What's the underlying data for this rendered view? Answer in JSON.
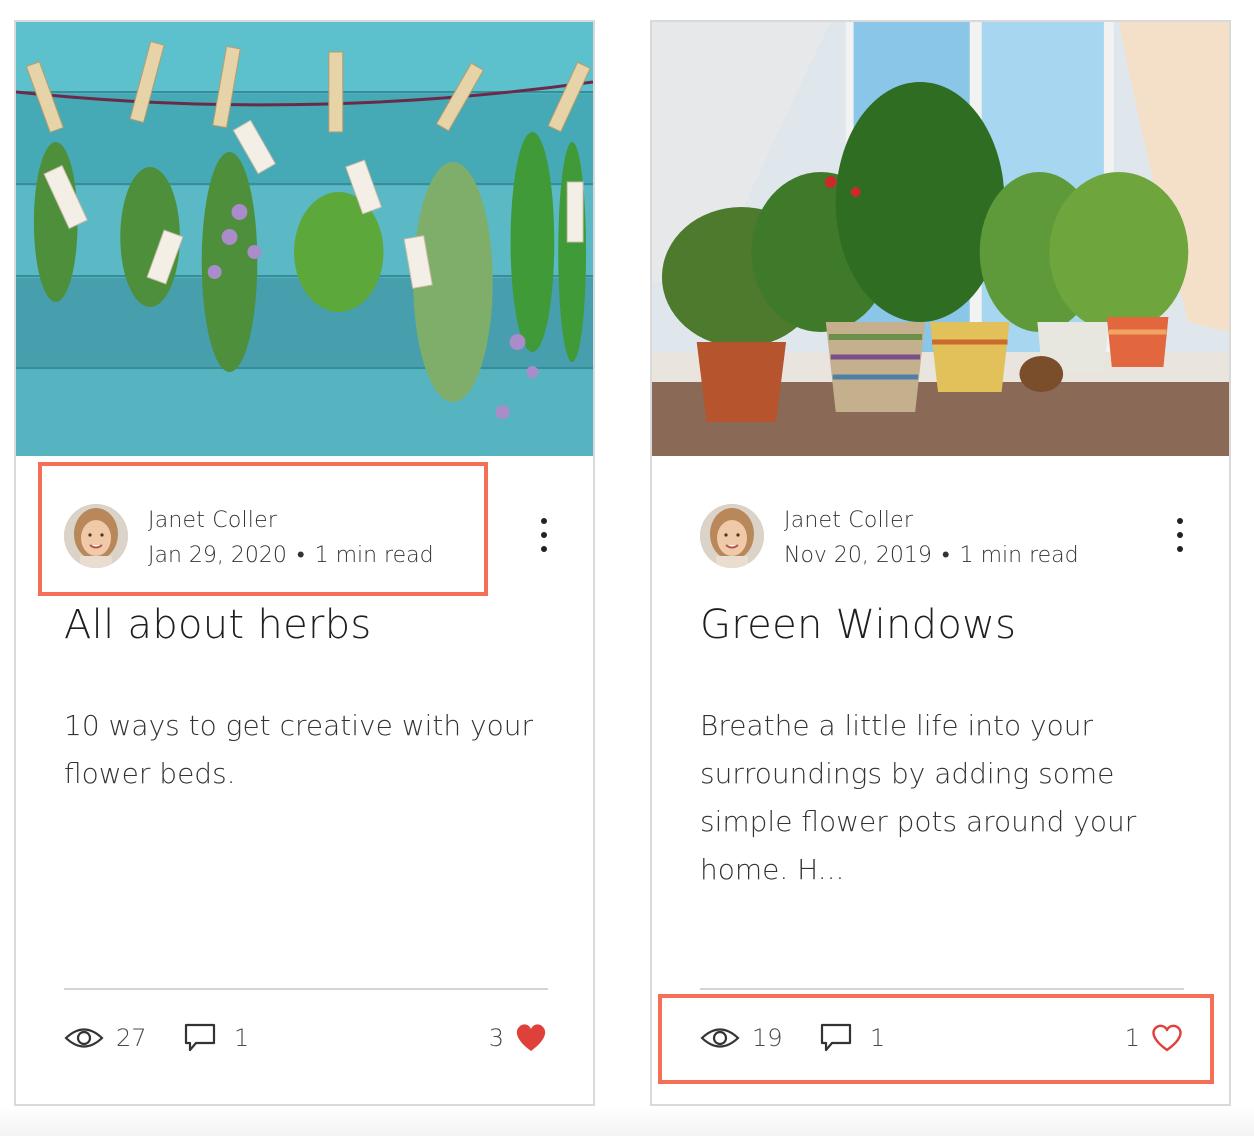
{
  "posts": [
    {
      "author": "Janet Coller",
      "date": "Jan 29, 2020",
      "separator": "•",
      "read_time": "1 min read",
      "title": "All about herbs",
      "excerpt": "10 ways to get creative with your flower beds.",
      "views": "27",
      "comments": "1",
      "likes": "3",
      "liked": true
    },
    {
      "author": "Janet Coller",
      "date": "Nov 20, 2019",
      "separator": "•",
      "read_time": "1 min read",
      "title": "Green Windows",
      "excerpt": "Breathe a little life into your surroundings by adding some simple flower pots around your home. H...",
      "views": "19",
      "comments": "1",
      "likes": "1",
      "liked": false
    }
  ],
  "colors": {
    "highlight": "#f46f55",
    "like_filled": "#e0403a",
    "like_outline": "#e0403a"
  }
}
